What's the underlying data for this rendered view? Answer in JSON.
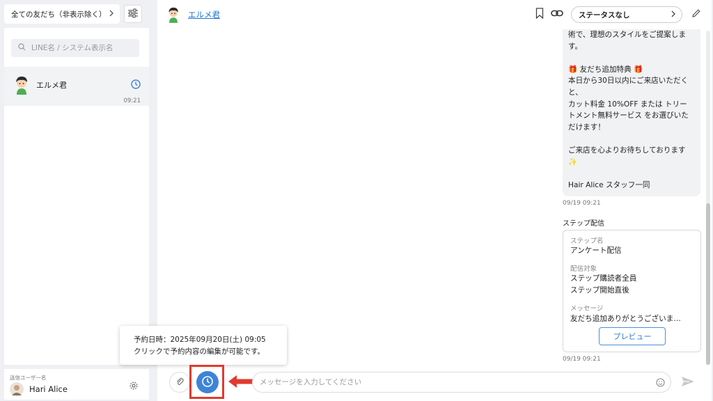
{
  "sidebar": {
    "filter_label": "全ての友だち（非表示除く）",
    "search_placeholder": "LINE名 / システム表示名",
    "friends": [
      {
        "name": "エルメ君",
        "time": "09:21"
      }
    ],
    "sender_label": "送信ユーザー名",
    "sender_name": "Hari Alice"
  },
  "header": {
    "name": "エルメ君",
    "status": "ステータスなし"
  },
  "messages": {
    "bubble_lines": [
      "術で、理想のスタイルをご提案しま",
      "す。",
      "",
      "友だち追加特典",
      "本日から30日以内にご来店いただく",
      "と、",
      "カット料金 10%OFF または トリー",
      "トメント無料サービス をお選びいた",
      "だけます！",
      "",
      "ご来店を心よりお待ちしております",
      "✨",
      "",
      "Hair Alice スタッフ一同"
    ],
    "bubble_time": "09/19 09:21",
    "step_title": "ステップ配信",
    "step_card": {
      "name_label": "ステップ名",
      "name_value": "アンケート配信",
      "target_label": "配信対象",
      "target_value_1": "ステップ購読者全員",
      "target_value_2": "ステップ開始直後",
      "message_label": "メッセージ",
      "message_value": "友だち追加ありがとうございま…",
      "preview_button": "プレビュー"
    },
    "step_time": "09/19 09:21"
  },
  "tooltip": {
    "line1": "予約日時：2025年09月20日(土) 09:05",
    "line2": "クリックで予約内容の編集が可能です。"
  },
  "input": {
    "placeholder": "メッセージを入力してください"
  },
  "icons": {
    "filter_chevron": "chevron-right-icon",
    "filter_settings": "sliders-icon",
    "search": "search-icon",
    "friend_status": "clock-icon",
    "sender_settings": "gear-icon",
    "bookmark": "bookmark-icon",
    "link": "link-icon",
    "status_chevron": "chevron-right-icon",
    "edit": "pencil-icon",
    "attach": "paperclip-icon",
    "schedule": "clock-icon",
    "annotation": "arrow-left-icon",
    "emoji": "smiley-icon",
    "send": "send-icon"
  },
  "colors": {
    "accent": "#3d84d8",
    "link": "#1a73d1",
    "highlight": "#e23a2e",
    "gift": "#e0463a"
  }
}
